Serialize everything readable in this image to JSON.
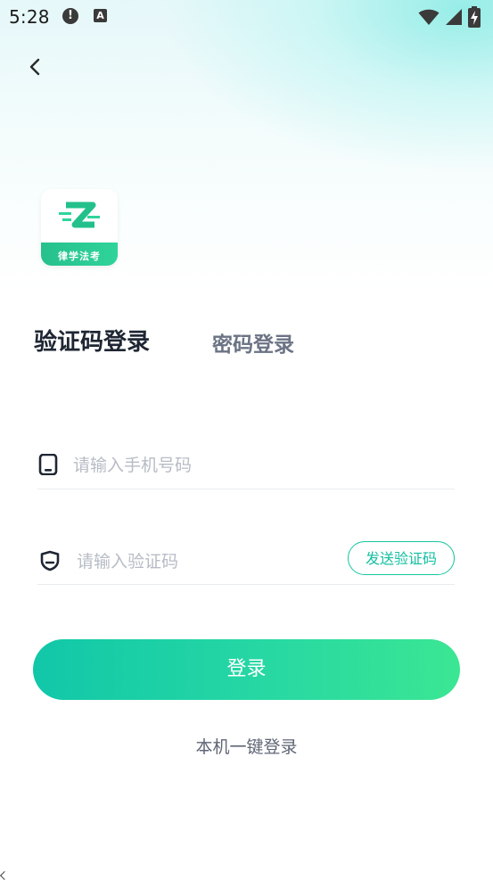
{
  "status_bar": {
    "time": "5:28",
    "alert_glyph": "!",
    "a_glyph": "A",
    "icons": [
      "alert-icon",
      "a-icon",
      "wifi-icon",
      "signal-icon",
      "battery-icon"
    ]
  },
  "header": {
    "back_icon": "chevron-left-icon"
  },
  "logo": {
    "text": "律学法考"
  },
  "tabs": [
    {
      "label": "验证码登录",
      "active": true
    },
    {
      "label": "密码登录",
      "active": false
    }
  ],
  "phone_field": {
    "icon": "phone-icon",
    "placeholder": "请输入手机号码",
    "value": ""
  },
  "code_field": {
    "icon": "shield-icon",
    "placeholder": "请输入验证码",
    "value": "",
    "send_label": "发送验证码"
  },
  "login_button": {
    "label": "登录"
  },
  "one_key_login": {
    "label": "本机一键登录"
  },
  "colors": {
    "accent": "#16c6a1",
    "button_start": "#11c7a8",
    "button_end": "#3be693",
    "active_tab": "#1f2633",
    "inactive_tab": "#6b7384",
    "placeholder": "#b7bcc5"
  }
}
